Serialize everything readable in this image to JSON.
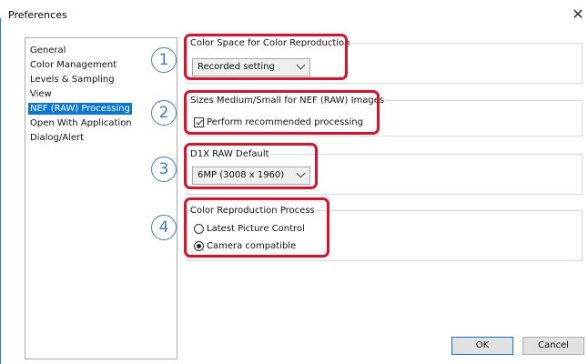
{
  "window": {
    "title": "Preferences",
    "close_glyph": "✕",
    "close_icon": "close-icon"
  },
  "categories": [
    {
      "label": "General",
      "selected": false
    },
    {
      "label": "Color Management",
      "selected": false
    },
    {
      "label": "Levels & Sampling",
      "selected": false
    },
    {
      "label": "View",
      "selected": false
    },
    {
      "label": "NEF (RAW) Processing",
      "selected": true
    },
    {
      "label": "Open With Application",
      "selected": false
    },
    {
      "label": "Dialog/Alert",
      "selected": false
    }
  ],
  "callouts": [
    "1",
    "2",
    "3",
    "4"
  ],
  "color_space": {
    "group_label": "Color Space for Color Reproduction",
    "selected_value": "Recorded setting"
  },
  "sizes": {
    "group_label": "Sizes Medium/Small for NEF (RAW) Images",
    "checkbox_label": "Perform recommended processing",
    "checked": true
  },
  "d1x": {
    "group_label": "D1X RAW Default",
    "selected_value": "6MP (3008 x 1960)"
  },
  "reproduction": {
    "group_label": "Color Reproduction Process",
    "options": [
      {
        "label": "Latest Picture Control",
        "selected": false
      },
      {
        "label": "Camera compatible",
        "selected": true
      }
    ]
  },
  "buttons": {
    "ok": "OK",
    "cancel": "Cancel"
  },
  "colors": {
    "accent": "#0a78d7",
    "callout_red": "#e0102a",
    "callout_blue": "#3b7fc4"
  }
}
